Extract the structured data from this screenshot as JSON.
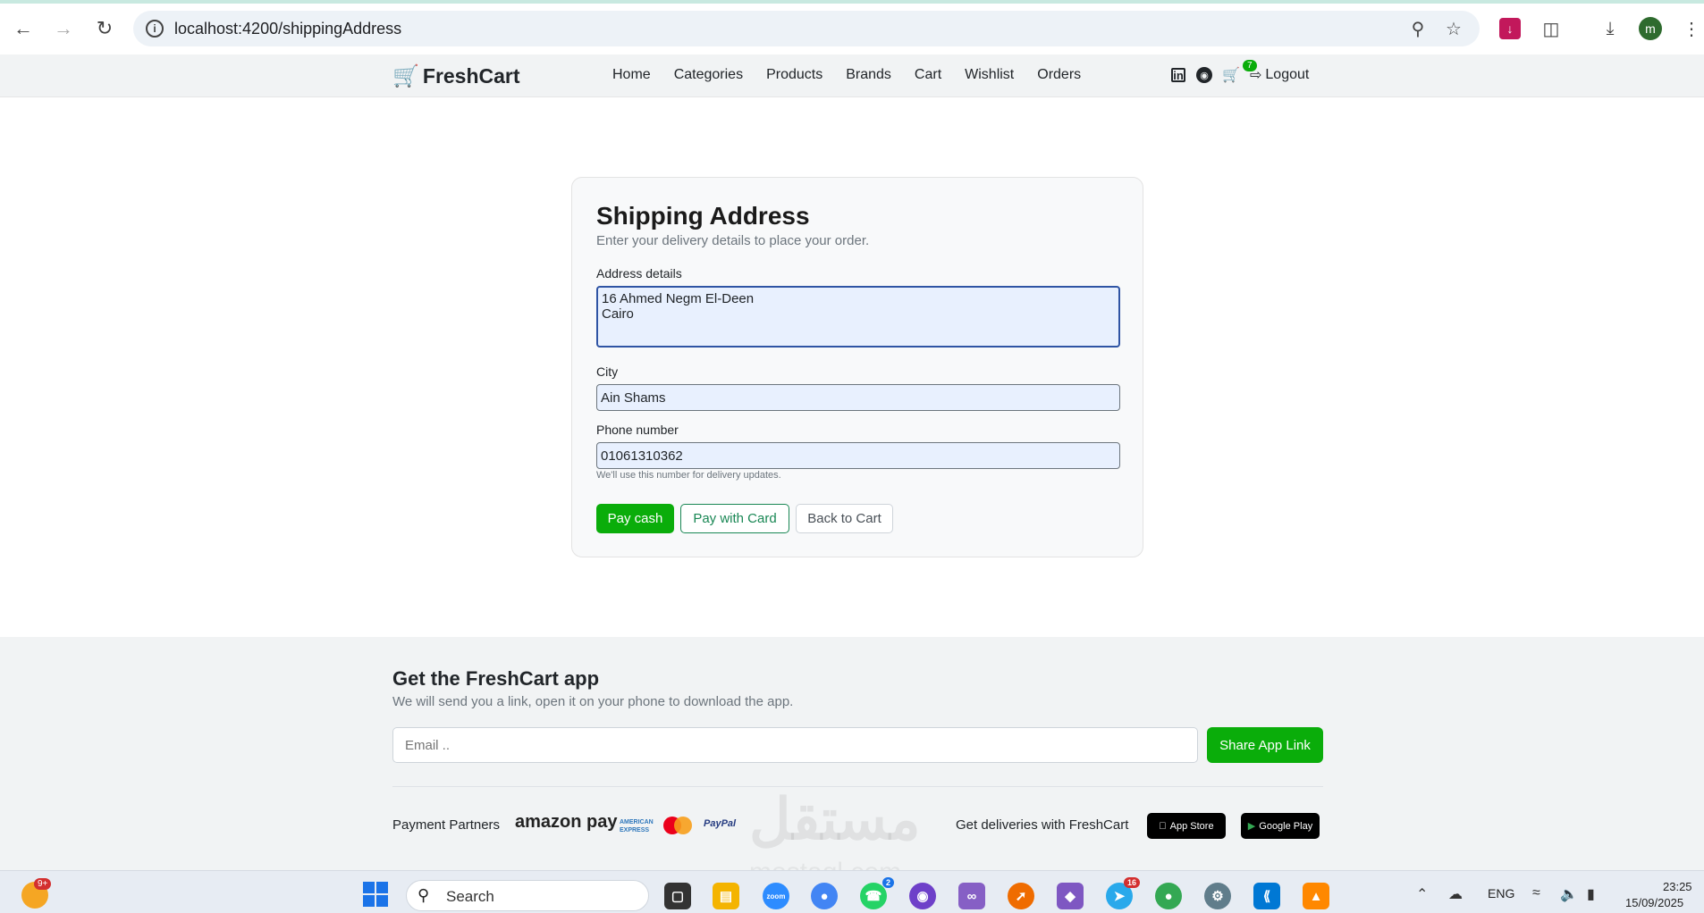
{
  "browser": {
    "url": "localhost:4200/shippingAddress",
    "profile_initial": "m"
  },
  "navbar": {
    "brand": "FreshCart",
    "links": [
      "Home",
      "Categories",
      "Products",
      "Brands",
      "Cart",
      "Wishlist",
      "Orders"
    ],
    "cart_count": "7",
    "logout_label": "Logout"
  },
  "form": {
    "title": "Shipping Address",
    "subtitle": "Enter your delivery details to place your order.",
    "address_label": "Address details",
    "address_value": "16 Ahmed Negm El-Deen\nCairo",
    "city_label": "City",
    "city_value": "Ain Shams",
    "phone_label": "Phone number",
    "phone_value": "01061310362",
    "phone_hint": "We'll use this number for delivery updates.",
    "pay_cash_label": "Pay cash",
    "pay_card_label": "Pay with Card",
    "back_cart_label": "Back to Cart"
  },
  "footer": {
    "title": "Get the FreshCart app",
    "subtitle": "We will send you a link, open it on your phone to download the app.",
    "email_placeholder": "Email ..",
    "share_label": "Share App Link",
    "payment_partners_label": "Payment Partners",
    "amazon_pay": "amazon pay",
    "amex": "AMERICAN EXPRESS",
    "paypal": "PayPal",
    "deliveries_label": "Get deliveries with FreshCart",
    "app_store": "App Store",
    "google_play": "Google Play"
  },
  "watermark": {
    "text": "مستقل",
    "sub": "mostaql.com"
  },
  "taskbar": {
    "search_label": "Search",
    "weather_badge": "9+",
    "whatsapp_badge": "2",
    "telegram_badge": "16",
    "lang": "ENG",
    "time": "23:25",
    "date": "15/09/2025"
  }
}
